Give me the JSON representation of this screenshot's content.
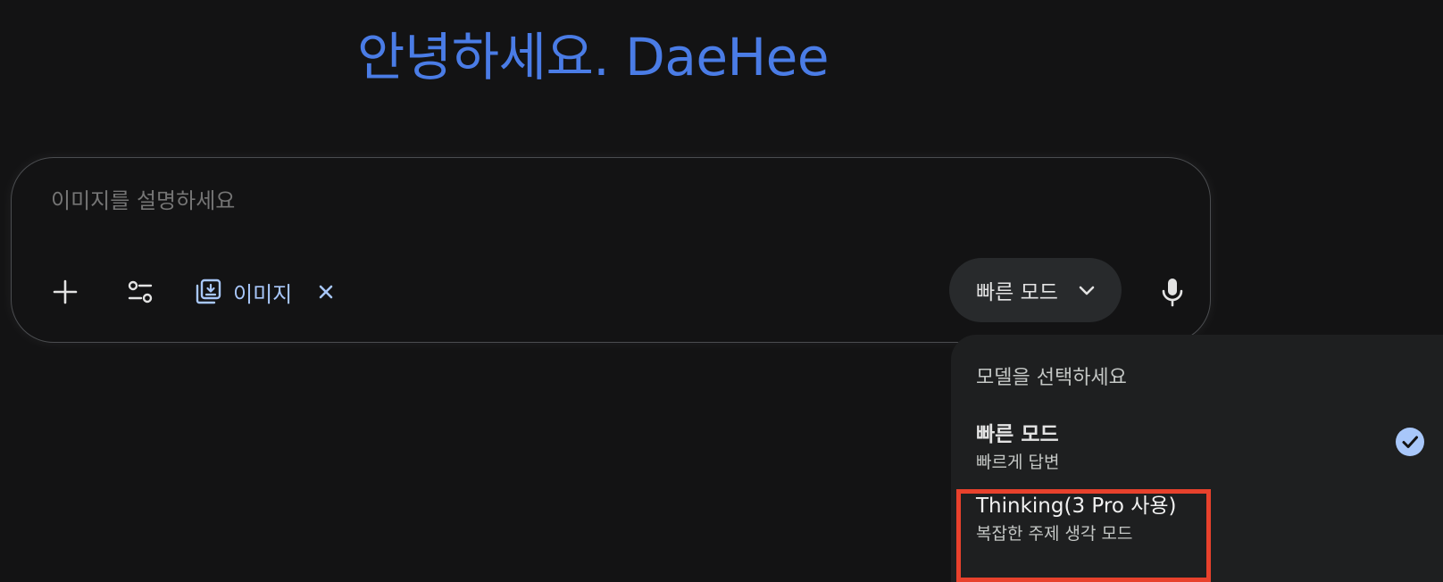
{
  "greeting": "안녕하세요. DaeHee",
  "composer": {
    "placeholder": "이미지를 설명하세요",
    "value": "",
    "image_chip_label": "이미지",
    "mode_button_label": "빠른 모드"
  },
  "model_menu": {
    "title": "모델을 선택하세요",
    "items": [
      {
        "title": "빠른 모드",
        "subtitle": "빠르게 답변",
        "selected": true
      },
      {
        "title": "Thinking(3 Pro 사용)",
        "subtitle": "복잡한 주제 생각 모드",
        "selected": false
      }
    ]
  },
  "colors": {
    "background": "#131314",
    "greeting": "#4a7ce6",
    "accent": "#a8c7fa",
    "menu_background": "#1e1f20",
    "highlight": "#e8412c"
  },
  "icons": [
    "plus-icon",
    "tools-icon",
    "image-library-icon",
    "close-icon",
    "chevron-down-icon",
    "mic-icon",
    "check-icon"
  ]
}
